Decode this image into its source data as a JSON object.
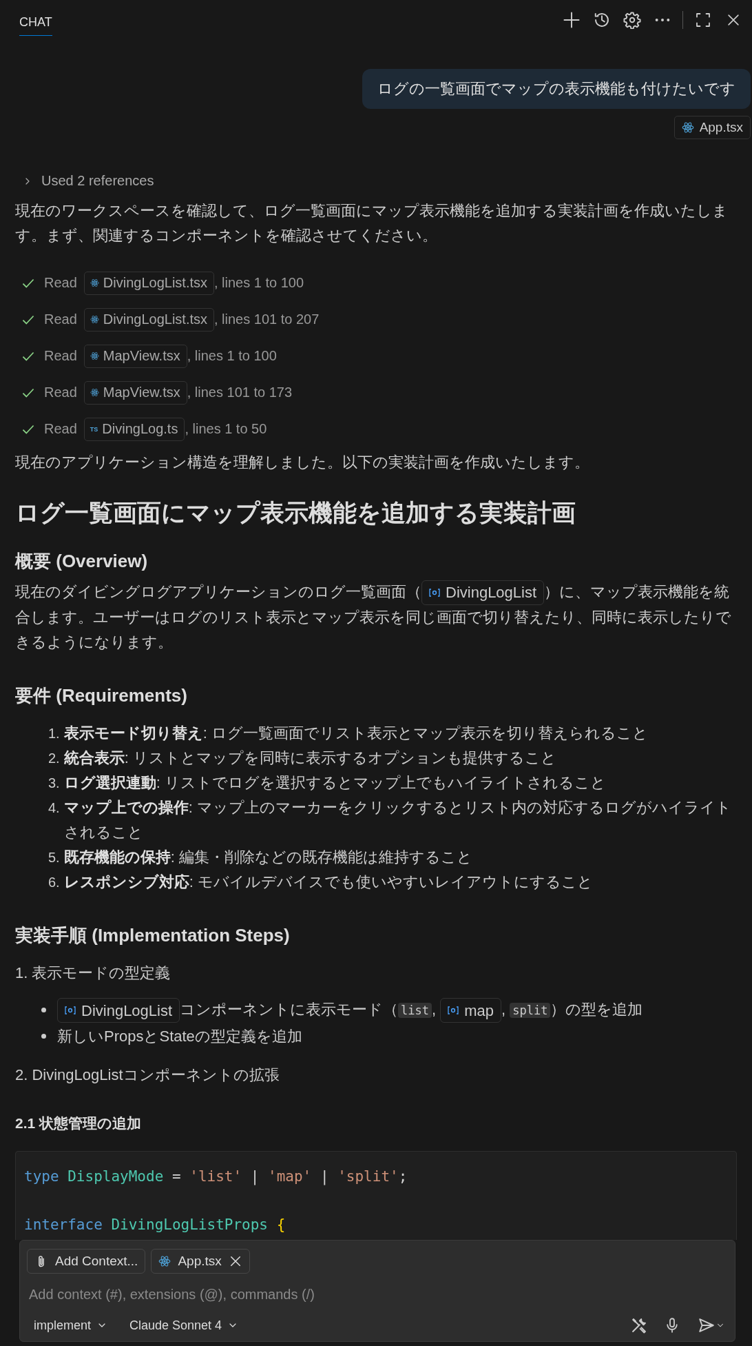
{
  "header": {
    "tab": {
      "label": "CHAT",
      "selected": true
    }
  },
  "user_message": {
    "text": "ログの一覧画面でマップの表示機能も付けたいです",
    "attachment": "App.tsx"
  },
  "references": {
    "label": "Used 2 references",
    "expanded": false
  },
  "intro": "現在のワークスペースを確認して、ログ一覧画面にマップ表示機能を追加する実装計画を作成いたします。まず、関連するコンポーネントを確認させてください。",
  "tool_calls": [
    {
      "verb": "Read",
      "file": "DivingLogList.tsx",
      "range": ", lines 1 to 100",
      "done": true
    },
    {
      "verb": "Read",
      "file": "DivingLogList.tsx",
      "range": ", lines 101 to 207",
      "done": true
    },
    {
      "verb": "Read",
      "file": "MapView.tsx",
      "range": ", lines 1 to 100",
      "done": true
    },
    {
      "verb": "Read",
      "file": "MapView.tsx",
      "range": ", lines 101 to 173",
      "done": true
    },
    {
      "verb": "Read",
      "file": "DivingLog.ts",
      "badge": "TS",
      "range": ", lines 1 to 50",
      "done": true
    }
  ],
  "summary": "現在のアプリケーション構造を理解しました。以下の実装計画を作成いたします。",
  "plan": [
    {
      "kind": "h1",
      "text": "ログ一覧画面にマップ表示機能を追加する実装計画"
    },
    {
      "kind": "h2",
      "text": "概要 (Overview)"
    },
    {
      "kind": "p",
      "parts": [
        {
          "kind": "text",
          "text": "現在のダイビングログアプリケーションのログ一覧画面（"
        },
        {
          "kind": "symbol",
          "text": "DivingLogList"
        },
        {
          "kind": "text",
          "text": "）に、マップ表示機能を統合します。ユーザーはログのリスト表示とマップ表示を同じ画面で切り替えたり、同時に表示したりできるようになります。"
        }
      ]
    },
    {
      "kind": "h2",
      "text": "要件 (Requirements)"
    },
    {
      "kind": "ol",
      "items": [
        {
          "number": "1.",
          "text": "**表示モード切り替え**: ログ一覧画面でリスト表示とマップ表示を切り替えられること"
        },
        {
          "number": "2.",
          "text": "**統合表示**: リストとマップを同時に表示するオプションも提供すること"
        },
        {
          "number": "3.",
          "text": "**ログ選択連動**: リストでログを選択するとマップ上でもハイライトされること"
        },
        {
          "number": "4.",
          "text": "**マップ上での操作**: マップ上のマーカーをクリックするとリスト内の対応するログがハイライトされること"
        },
        {
          "number": "5.",
          "text": "**既存機能の保持**: 編集・削除などの既存機能は維持すること"
        },
        {
          "number": "6.",
          "text": "**レスポンシブ対応**: モバイルデバイスでも使いやすいレイアウトにすること"
        }
      ]
    },
    {
      "kind": "h2",
      "text": "実装手順 (Implementation Steps)"
    },
    {
      "kind": "step",
      "text": "1. 表示モードの型定義"
    },
    {
      "kind": "ul",
      "items": [
        {
          "parts": [
            {
              "kind": "symbol",
              "text": "DivingLogList"
            },
            {
              "kind": "text",
              "text": "コンポーネントに表示モード（"
            },
            {
              "kind": "code",
              "text": "list"
            },
            {
              "kind": "text",
              "text": ", "
            },
            {
              "kind": "symbol",
              "text": "map"
            },
            {
              "kind": "text",
              "text": ", "
            },
            {
              "kind": "code",
              "text": "split"
            },
            {
              "kind": "text",
              "text": "）の型を追加"
            }
          ]
        },
        {
          "parts": [
            {
              "kind": "text",
              "text": "新しいPropsとStateの型定義を追加"
            }
          ]
        }
      ]
    },
    {
      "kind": "step",
      "text": "2. DivingLogListコンポーネントの拡張"
    },
    {
      "kind": "h4",
      "text": "2.1 状態管理の追加"
    },
    {
      "kind": "code",
      "lines": [
        [
          {
            "kind": "keyword",
            "text": "type"
          },
          {
            "kind": "type",
            "text": " DisplayMode"
          },
          {
            "kind": "plain",
            "text": " = "
          },
          {
            "kind": "string",
            "text": "'list'"
          },
          {
            "kind": "plain",
            "text": " | "
          },
          {
            "kind": "string",
            "text": "'map'"
          },
          {
            "kind": "plain",
            "text": " | "
          },
          {
            "kind": "string",
            "text": "'split'"
          },
          {
            "kind": "plain",
            "text": ";"
          }
        ],
        [
          {
            "kind": "keyword",
            "text": "interface"
          },
          {
            "kind": "type",
            "text": " DivingLogListProps"
          },
          {
            "kind": "bracket",
            "text": " {"
          }
        ]
      ]
    }
  ],
  "input": {
    "chips": [
      {
        "kind": "attach",
        "label": "Add Context..."
      },
      {
        "kind": "file",
        "label": "App.tsx"
      }
    ],
    "placeholder": "Add context (#), extensions (@), commands (/)",
    "mode": "implement",
    "model": "Claude Sonnet 4"
  }
}
